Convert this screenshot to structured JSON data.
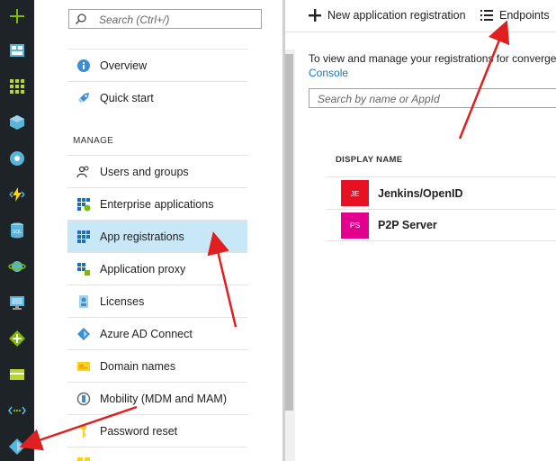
{
  "sidebar": {
    "search_placeholder": "Search (Ctrl+/)",
    "manage_header": "MANAGE",
    "items": [
      {
        "label": "Overview",
        "icon": "info-icon"
      },
      {
        "label": "Quick start",
        "icon": "rocket-icon"
      },
      {
        "label": "Users and groups",
        "icon": "users-icon"
      },
      {
        "label": "Enterprise applications",
        "icon": "grid-apps-icon"
      },
      {
        "label": "App registrations",
        "icon": "grid-apps-icon"
      },
      {
        "label": "Application proxy",
        "icon": "proxy-icon"
      },
      {
        "label": "Licenses",
        "icon": "license-icon"
      },
      {
        "label": "Azure AD Connect",
        "icon": "diamond-icon"
      },
      {
        "label": "Domain names",
        "icon": "domain-card-icon"
      },
      {
        "label": "Mobility (MDM and MAM)",
        "icon": "mobility-icon"
      },
      {
        "label": "Password reset",
        "icon": "key-icon"
      }
    ]
  },
  "toolbar": {
    "new_registration": "New application registration",
    "endpoints": "Endpoints"
  },
  "main": {
    "info_text": "To view and manage your registrations for converge",
    "info_link": "Console",
    "filter_placeholder": "Search by name or AppId",
    "column_header": "DISPLAY NAME",
    "apps": [
      {
        "initials": "JE",
        "name": "Jenkins/OpenID",
        "color": "#e81123"
      },
      {
        "initials": "PS",
        "name": "P2P Server",
        "color": "#e3008c"
      }
    ]
  },
  "colors": {
    "rail_bg": "#1e2328",
    "selected_bg": "#c8e8f8",
    "link": "#1874c1",
    "arrow": "#e02020"
  }
}
